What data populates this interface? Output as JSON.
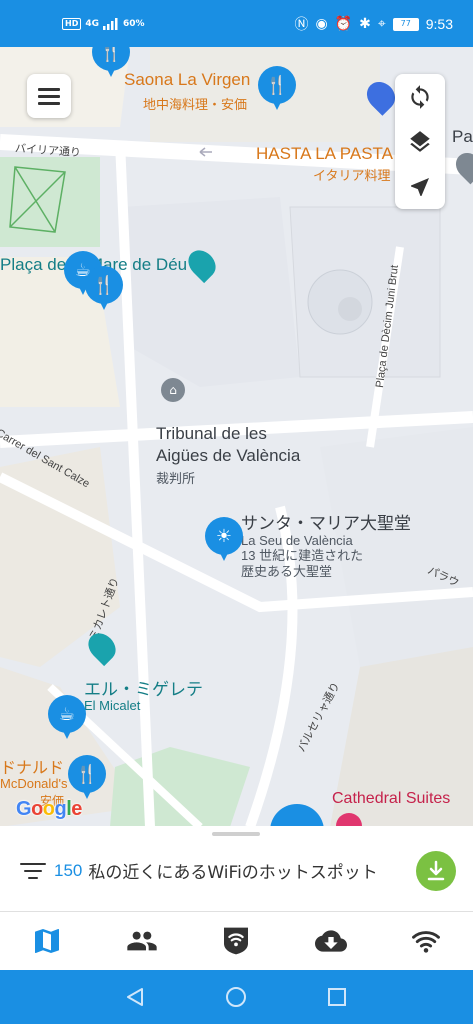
{
  "status_bar": {
    "hd": "HD",
    "network": "4G",
    "signal_label": "60%",
    "battery": "77",
    "time": "9:53"
  },
  "map": {
    "pois": [
      {
        "name": "Saona La Virgen",
        "sub": "地中海料理・安価"
      },
      {
        "name": "HASTA LA PASTA",
        "sub": "イタリア料理"
      },
      {
        "name": "Plaça de la Mare de Déu"
      },
      {
        "name": "Tribunal de les Aigües de València",
        "sub": "裁判所"
      },
      {
        "name": "サンタ・マリア大聖堂",
        "sub": "La Seu de València",
        "desc": "13 世紀に建造された歴史ある大聖堂"
      },
      {
        "name": "エル・ミゲレテ",
        "sub": "El Micalet"
      },
      {
        "name": "ドナルド",
        "sub": "McDonald's",
        "extra": "安価"
      },
      {
        "name": "Cathedral Suites"
      },
      {
        "name": "Pa"
      }
    ],
    "streets": [
      "バイリア通り",
      "Plaça de Dècim Juni Brut",
      "Carrer del Sant Calze",
      "ミカレト通り",
      "バルセリャ通り",
      "パラウ"
    ],
    "attribution": "Google"
  },
  "controls": {
    "menu": "menu",
    "refresh": "refresh",
    "layers": "layers",
    "locate": "locate"
  },
  "sheet": {
    "count": "150",
    "text": "私の近くにあるWiFiのホットスポット"
  },
  "tabs": [
    {
      "name": "map-tab",
      "icon": "map-icon"
    },
    {
      "name": "people-tab",
      "icon": "people-icon"
    },
    {
      "name": "vpn-tab",
      "icon": "shield-wifi-icon"
    },
    {
      "name": "download-tab",
      "icon": "cloud-download-icon"
    },
    {
      "name": "wifi-tab",
      "icon": "wifi-icon"
    }
  ],
  "colors": {
    "accent": "#1a8fe3",
    "download": "#7bc142"
  }
}
